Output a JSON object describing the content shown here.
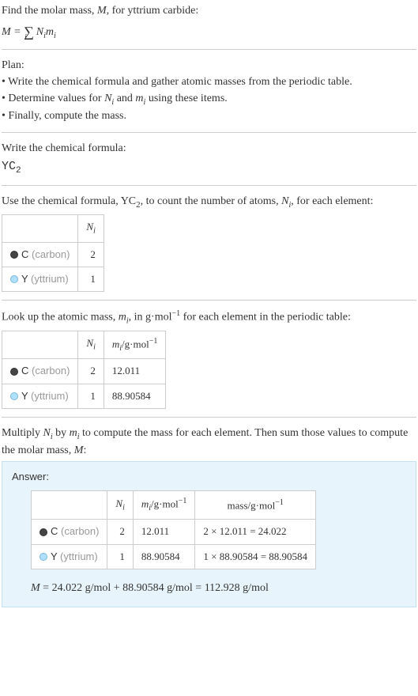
{
  "intro": {
    "line1": "Find the molar mass, ",
    "line1_var": "M",
    "line1_end": ", for yttrium carbide:",
    "formula_M": "M",
    "formula_eq": " = ",
    "formula_sum": "∑",
    "formula_i": "i",
    "formula_Ni": "N",
    "formula_Ni_sub": "i",
    "formula_mi": "m",
    "formula_mi_sub": "i"
  },
  "plan": {
    "header": "Plan:",
    "b1": "• Write the chemical formula and gather atomic masses from the periodic table.",
    "b2_start": "• Determine values for ",
    "b2_N": "N",
    "b2_Ni": "i",
    "b2_and": " and ",
    "b2_m": "m",
    "b2_mi": "i",
    "b2_end": " using these items.",
    "b3": "• Finally, compute the mass."
  },
  "chem": {
    "header": "Write the chemical formula:",
    "formula_base": "YC",
    "formula_sub": "2"
  },
  "count": {
    "line_start": "Use the chemical formula, YC",
    "line_sub": "2",
    "line_mid": ", to count the number of atoms, ",
    "line_N": "N",
    "line_Ni": "i",
    "line_end": ", for each element:",
    "col_N": "N",
    "col_N_sub": "i",
    "rows": [
      {
        "elem_letter": "C",
        "elem_name": " (carbon)",
        "n": "2",
        "dot": "dot-c"
      },
      {
        "elem_letter": "Y",
        "elem_name": " (yttrium)",
        "n": "1",
        "dot": "dot-y"
      }
    ]
  },
  "lookup": {
    "line_start": "Look up the atomic mass, ",
    "line_m": "m",
    "line_mi": "i",
    "line_mid": ", in g·mol",
    "line_exp": "−1",
    "line_end": " for each element in the periodic table:",
    "col_N": "N",
    "col_N_sub": "i",
    "col_m_pre": "m",
    "col_m_sub": "i",
    "col_m_mid": "/g·mol",
    "col_m_exp": "−1",
    "rows": [
      {
        "elem_letter": "C",
        "elem_name": " (carbon)",
        "n": "2",
        "m": "12.011",
        "dot": "dot-c"
      },
      {
        "elem_letter": "Y",
        "elem_name": " (yttrium)",
        "n": "1",
        "m": "88.90584",
        "dot": "dot-y"
      }
    ]
  },
  "multiply": {
    "line_start": "Multiply ",
    "line_N": "N",
    "line_Ni": "i",
    "line_by": " by ",
    "line_m": "m",
    "line_mi": "i",
    "line_mid": " to compute the mass for each element. Then sum those values to compute the molar mass, ",
    "line_M": "M",
    "line_end": ":"
  },
  "answer": {
    "label": "Answer:",
    "col_N": "N",
    "col_N_sub": "i",
    "col_m_pre": "m",
    "col_m_sub": "i",
    "col_m_mid": "/g·mol",
    "col_m_exp": "−1",
    "col_mass_pre": "mass/g·mol",
    "col_mass_exp": "−1",
    "rows": [
      {
        "elem_letter": "C",
        "elem_name": " (carbon)",
        "n": "2",
        "m": "12.011",
        "mass": "2 × 12.011 = 24.022",
        "dot": "dot-c"
      },
      {
        "elem_letter": "Y",
        "elem_name": " (yttrium)",
        "n": "1",
        "m": "88.90584",
        "mass": "1 × 88.90584 = 88.90584",
        "dot": "dot-y"
      }
    ],
    "final_M": "M",
    "final_eq": " = 24.022 g/mol + 88.90584 g/mol = 112.928 g/mol"
  }
}
